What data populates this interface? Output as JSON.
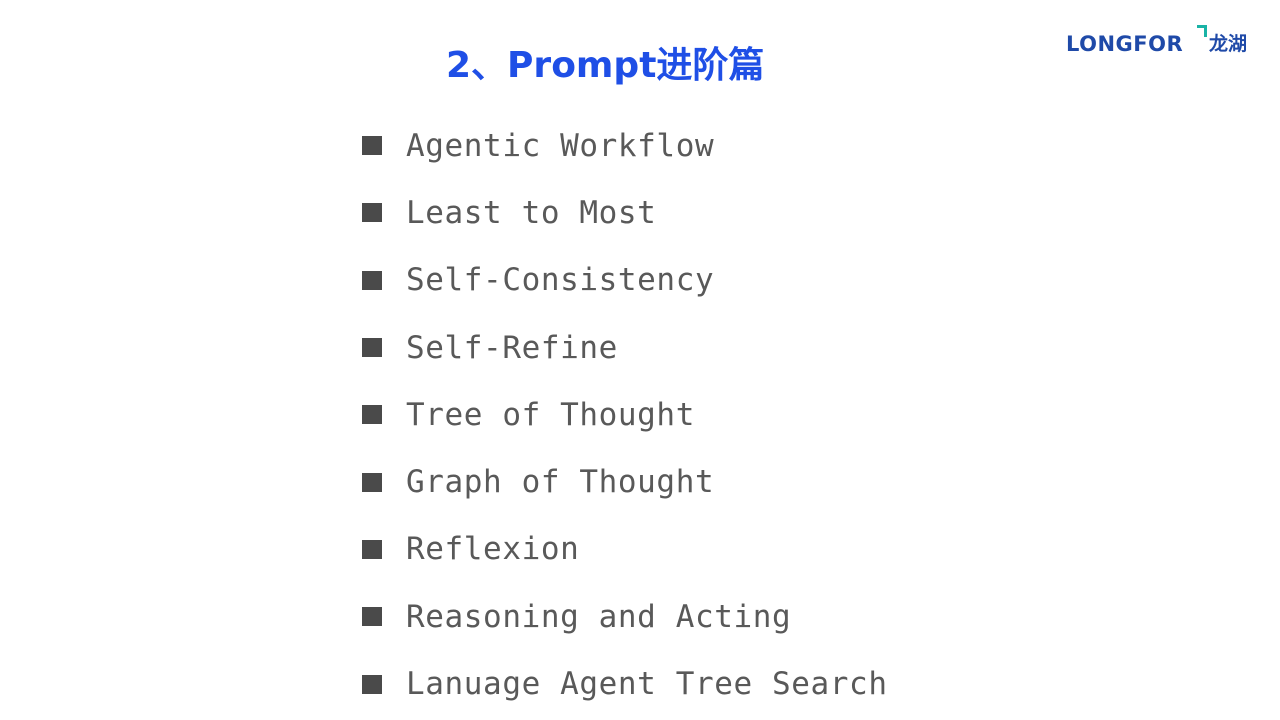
{
  "slide": {
    "title": "2、Prompt进阶篇",
    "logo": {
      "text_en": "LONGFOR",
      "text_cn": "龙湖",
      "brand_color": "#1f4aa8",
      "accent_color": "#19b3a6"
    },
    "title_color": "#1f4fe6",
    "items": [
      {
        "label": "Agentic Workflow"
      },
      {
        "label": "Least to Most"
      },
      {
        "label": "Self-Consistency"
      },
      {
        "label": "Self-Refine"
      },
      {
        "label": "Tree of Thought"
      },
      {
        "label": "Graph of Thought"
      },
      {
        "label": "Reflexion"
      },
      {
        "label": "Reasoning and Acting"
      },
      {
        "label": "Lanuage Agent Tree Search"
      }
    ]
  }
}
